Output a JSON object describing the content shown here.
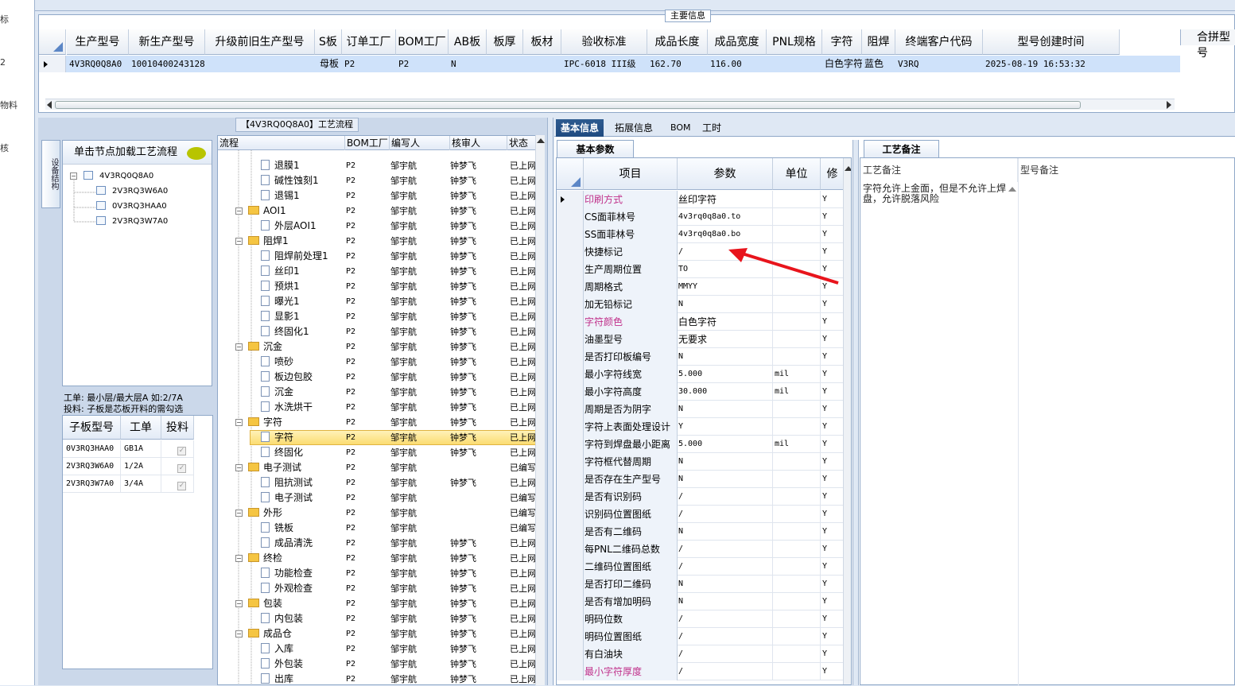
{
  "left_strip": [
    "标",
    "2",
    "物料",
    "核"
  ],
  "main_info": {
    "legend": "主要信息",
    "corner_label": "合拼型号",
    "columns": [
      "生产型号",
      "新生产型号",
      "升级前旧生产型号",
      "S板",
      "订单工厂",
      "BOM工厂",
      "AB板",
      "板厚",
      "板材",
      "验收标准",
      "成品长度",
      "成品宽度",
      "PNL规格",
      "字符",
      "阻焊",
      "终端客户代码",
      "型号创建时间"
    ],
    "row": {
      "生产型号": "4V3RQ0Q8A0",
      "新生产型号": "10010400243128",
      "升级前旧生产型号": "",
      "S板": "母板",
      "订单工厂": "P2",
      "BOM工厂": "P2",
      "AB板": "N",
      "板厚": "",
      "板材": "",
      "验收标准": "IPC-6018 III级",
      "成品长度": "162.70",
      "成品宽度": "116.00",
      "PNL规格": "",
      "字符": "白色字符",
      "阻焊": "蓝色",
      "终端客户代码": "V3RQ",
      "型号创建时间": "2025-08-19 16:53:32"
    }
  },
  "process": {
    "title": "【4V3RQ0Q8A0】工艺流程",
    "side_tab": "设备结构",
    "tree_header": "单击节点加载工艺流程",
    "tree": [
      {
        "label": "4V3RQ0Q8A0",
        "level": 0
      },
      {
        "label": "2V3RQ3W6A0",
        "level": 1
      },
      {
        "label": "0V3RQ3HAA0",
        "level": 1
      },
      {
        "label": "2V3RQ3W7A0",
        "level": 1
      }
    ],
    "notes": [
      "工单: 最小层/最大层A 如:2/7A",
      "投料: 子板是芯板开料的需勾选"
    ],
    "subboard_headers": [
      "子板型号",
      "工单",
      "投料"
    ],
    "subboards": [
      {
        "model": "0V3RQ3HAA0",
        "order": "GB1A",
        "feed": "✓"
      },
      {
        "model": "2V3RQ3W6A0",
        "order": "1/2A",
        "feed": "✓"
      },
      {
        "model": "2V3RQ3W7A0",
        "order": "3/4A",
        "feed": "✓"
      }
    ],
    "flow_headers": [
      "流程",
      "BOM工厂",
      "编写人",
      "核审人",
      "状态"
    ],
    "flow_rows": [
      {
        "name": "退膜1",
        "type": "doc",
        "bom": "P2",
        "writer": "邹宇航",
        "reviewer": "钟梦飞",
        "status": "已上网"
      },
      {
        "name": "碱性蚀刻1",
        "type": "doc",
        "bom": "P2",
        "writer": "邹宇航",
        "reviewer": "钟梦飞",
        "status": "已上网"
      },
      {
        "name": "退锡1",
        "type": "doc",
        "bom": "P2",
        "writer": "邹宇航",
        "reviewer": "钟梦飞",
        "status": "已上网"
      },
      {
        "name": "AOI1",
        "type": "folder",
        "bom": "P2",
        "writer": "邹宇航",
        "reviewer": "钟梦飞",
        "status": "已上网"
      },
      {
        "name": "外层AOI1",
        "type": "doc",
        "bom": "P2",
        "writer": "邹宇航",
        "reviewer": "钟梦飞",
        "status": "已上网"
      },
      {
        "name": "阻焊1",
        "type": "folder",
        "bom": "P2",
        "writer": "邹宇航",
        "reviewer": "钟梦飞",
        "status": "已上网"
      },
      {
        "name": "阻焊前处理1",
        "type": "doc",
        "bom": "P2",
        "writer": "邹宇航",
        "reviewer": "钟梦飞",
        "status": "已上网"
      },
      {
        "name": "丝印1",
        "type": "doc",
        "bom": "P2",
        "writer": "邹宇航",
        "reviewer": "钟梦飞",
        "status": "已上网"
      },
      {
        "name": "预烘1",
        "type": "doc",
        "bom": "P2",
        "writer": "邹宇航",
        "reviewer": "钟梦飞",
        "status": "已上网"
      },
      {
        "name": "曝光1",
        "type": "doc",
        "bom": "P2",
        "writer": "邹宇航",
        "reviewer": "钟梦飞",
        "status": "已上网"
      },
      {
        "name": "显影1",
        "type": "doc",
        "bom": "P2",
        "writer": "邹宇航",
        "reviewer": "钟梦飞",
        "status": "已上网"
      },
      {
        "name": "终固化1",
        "type": "doc",
        "bom": "P2",
        "writer": "邹宇航",
        "reviewer": "钟梦飞",
        "status": "已上网"
      },
      {
        "name": "沉金",
        "type": "folder",
        "bom": "P2",
        "writer": "邹宇航",
        "reviewer": "钟梦飞",
        "status": "已上网"
      },
      {
        "name": "喷砂",
        "type": "doc",
        "bom": "P2",
        "writer": "邹宇航",
        "reviewer": "钟梦飞",
        "status": "已上网"
      },
      {
        "name": "板边包胶",
        "type": "doc",
        "bom": "P2",
        "writer": "邹宇航",
        "reviewer": "钟梦飞",
        "status": "已上网"
      },
      {
        "name": "沉金",
        "type": "doc",
        "bom": "P2",
        "writer": "邹宇航",
        "reviewer": "钟梦飞",
        "status": "已上网"
      },
      {
        "name": "水洗烘干",
        "type": "doc",
        "bom": "P2",
        "writer": "邹宇航",
        "reviewer": "钟梦飞",
        "status": "已上网"
      },
      {
        "name": "字符",
        "type": "folder",
        "bom": "P2",
        "writer": "邹宇航",
        "reviewer": "钟梦飞",
        "status": "已上网"
      },
      {
        "name": "字符",
        "type": "doc",
        "bom": "P2",
        "writer": "邹宇航",
        "reviewer": "钟梦飞",
        "status": "已上网",
        "selected": true
      },
      {
        "name": "终固化",
        "type": "doc",
        "bom": "P2",
        "writer": "邹宇航",
        "reviewer": "钟梦飞",
        "status": "已上网"
      },
      {
        "name": "电子测试",
        "type": "folder",
        "bom": "P2",
        "writer": "邹宇航",
        "reviewer": "",
        "status": "已编写"
      },
      {
        "name": "阻抗测试",
        "type": "doc",
        "bom": "P2",
        "writer": "邹宇航",
        "reviewer": "钟梦飞",
        "status": "已上网"
      },
      {
        "name": "电子测试",
        "type": "doc",
        "bom": "P2",
        "writer": "邹宇航",
        "reviewer": "",
        "status": "已编写"
      },
      {
        "name": "外形",
        "type": "folder",
        "bom": "P2",
        "writer": "邹宇航",
        "reviewer": "",
        "status": "已编写"
      },
      {
        "name": "铣板",
        "type": "doc",
        "bom": "P2",
        "writer": "邹宇航",
        "reviewer": "",
        "status": "已编写"
      },
      {
        "name": "成品清洗",
        "type": "doc",
        "bom": "P2",
        "writer": "邹宇航",
        "reviewer": "钟梦飞",
        "status": "已上网"
      },
      {
        "name": "终检",
        "type": "folder",
        "bom": "P2",
        "writer": "邹宇航",
        "reviewer": "钟梦飞",
        "status": "已上网"
      },
      {
        "name": "功能检查",
        "type": "doc",
        "bom": "P2",
        "writer": "邹宇航",
        "reviewer": "钟梦飞",
        "status": "已上网"
      },
      {
        "name": "外观检查",
        "type": "doc",
        "bom": "P2",
        "writer": "邹宇航",
        "reviewer": "钟梦飞",
        "status": "已上网"
      },
      {
        "name": "包装",
        "type": "folder",
        "bom": "P2",
        "writer": "邹宇航",
        "reviewer": "钟梦飞",
        "status": "已上网"
      },
      {
        "name": "内包装",
        "type": "doc",
        "bom": "P2",
        "writer": "邹宇航",
        "reviewer": "钟梦飞",
        "status": "已上网"
      },
      {
        "name": "成品仓",
        "type": "folder",
        "bom": "P2",
        "writer": "邹宇航",
        "reviewer": "钟梦飞",
        "status": "已上网"
      },
      {
        "name": "入库",
        "type": "doc",
        "bom": "P2",
        "writer": "邹宇航",
        "reviewer": "钟梦飞",
        "status": "已上网"
      },
      {
        "name": "外包装",
        "type": "doc",
        "bom": "P2",
        "writer": "邹宇航",
        "reviewer": "钟梦飞",
        "status": "已上网"
      },
      {
        "name": "出库",
        "type": "doc",
        "bom": "P2",
        "writer": "邹宇航",
        "reviewer": "钟梦飞",
        "status": "已上网"
      }
    ]
  },
  "right": {
    "tabs": [
      "基本信息",
      "拓展信息",
      "BOM",
      "工时"
    ],
    "subtab_params": "基本参数",
    "subtab_notes": "工艺备注",
    "param_headers": [
      "项目",
      "参数",
      "单位",
      "修"
    ],
    "params": [
      {
        "k": "印刷方式",
        "v": "丝印字符",
        "u": "",
        "m": "Y",
        "pink": true
      },
      {
        "k": "CS面菲林号",
        "v": "4v3rq0q8a0.to",
        "u": "",
        "m": "Y"
      },
      {
        "k": "SS面菲林号",
        "v": "4v3rq0q8a0.bo",
        "u": "",
        "m": "Y"
      },
      {
        "k": "快捷标记",
        "v": "/",
        "u": "",
        "m": "Y"
      },
      {
        "k": "生产周期位置",
        "v": "TO",
        "u": "",
        "m": "Y"
      },
      {
        "k": "周期格式",
        "v": "MMYY",
        "u": "",
        "m": "Y"
      },
      {
        "k": "加无铅标记",
        "v": "N",
        "u": "",
        "m": "Y"
      },
      {
        "k": "字符颜色",
        "v": "白色字符",
        "u": "",
        "m": "Y",
        "pink": true
      },
      {
        "k": "油墨型号",
        "v": "无要求",
        "u": "",
        "m": "Y"
      },
      {
        "k": "是否打印板编号",
        "v": "N",
        "u": "",
        "m": "Y"
      },
      {
        "k": "最小字符线宽",
        "v": "5.000",
        "u": "mil",
        "m": "Y"
      },
      {
        "k": "最小字符高度",
        "v": "30.000",
        "u": "mil",
        "m": "Y"
      },
      {
        "k": "周期是否为阴字",
        "v": "N",
        "u": "",
        "m": "Y"
      },
      {
        "k": "字符上表面处理设计",
        "v": "Y",
        "u": "",
        "m": "Y"
      },
      {
        "k": "字符到焊盘最小距离",
        "v": "5.000",
        "u": "mil",
        "m": "Y"
      },
      {
        "k": "字符框代替周期",
        "v": "N",
        "u": "",
        "m": "Y"
      },
      {
        "k": "是否存在生产型号",
        "v": "N",
        "u": "",
        "m": "Y"
      },
      {
        "k": "是否有识别码",
        "v": "/",
        "u": "",
        "m": "Y"
      },
      {
        "k": "识别码位置图纸",
        "v": "/",
        "u": "",
        "m": "Y"
      },
      {
        "k": "是否有二维码",
        "v": "N",
        "u": "",
        "m": "Y"
      },
      {
        "k": "每PNL二维码总数",
        "v": "/",
        "u": "",
        "m": "Y"
      },
      {
        "k": "二维码位置图纸",
        "v": "/",
        "u": "",
        "m": "Y"
      },
      {
        "k": "是否打印二维码",
        "v": "N",
        "u": "",
        "m": "Y"
      },
      {
        "k": "是否有增加明码",
        "v": "N",
        "u": "",
        "m": "Y"
      },
      {
        "k": "明码位数",
        "v": "/",
        "u": "",
        "m": "Y"
      },
      {
        "k": "明码位置图纸",
        "v": "/",
        "u": "",
        "m": "Y"
      },
      {
        "k": "有白油块",
        "v": "/",
        "u": "",
        "m": "Y"
      },
      {
        "k": "最小字符厚度",
        "v": "/",
        "u": "",
        "m": "Y",
        "pink": true
      }
    ],
    "notes_headers": [
      "工艺备注",
      "型号备注"
    ],
    "process_note": "字符允许上金面，但是不允许上焊盘，允许脱落风险"
  },
  "colors": {
    "accent": "#1f4a80",
    "selected_row": "#cfe2fa",
    "highlight": "#fbdc72",
    "pink": "#c0308a",
    "arrow": "#e8141c"
  }
}
